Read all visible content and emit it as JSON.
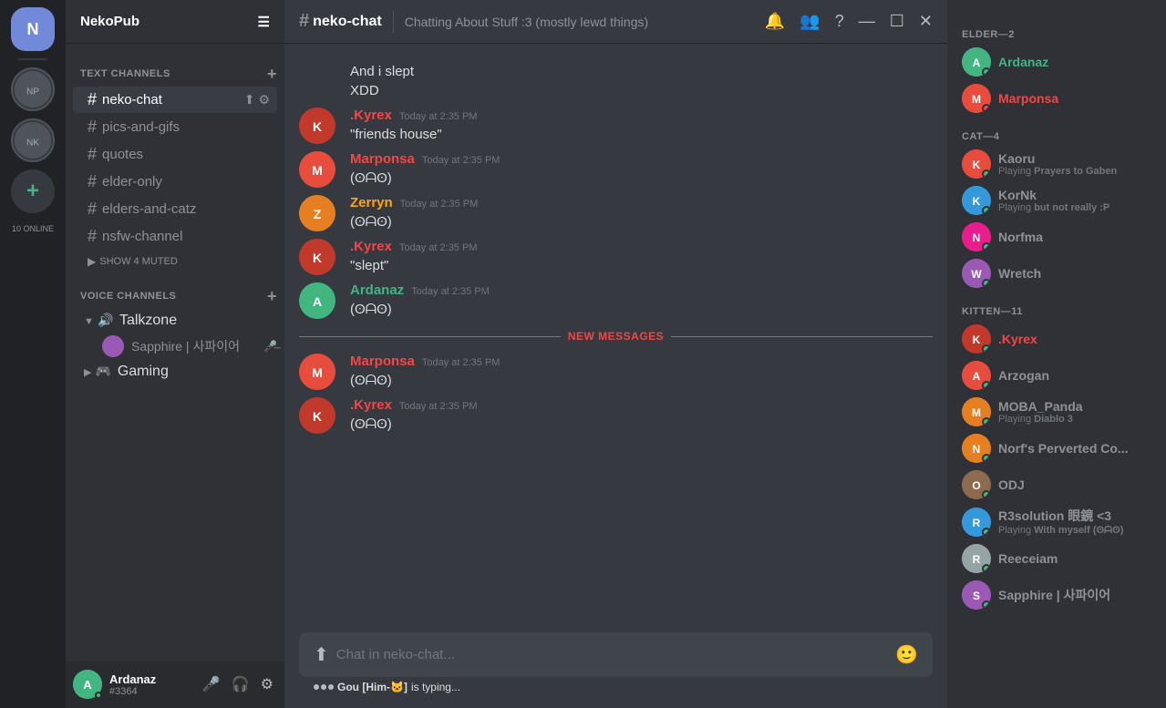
{
  "app": {
    "online_count": "10 ONLINE"
  },
  "server": {
    "name": "NekoPub"
  },
  "channel": {
    "name": "neko-chat",
    "description": "Chatting About Stuff :3 (mostly lewd things)",
    "input_placeholder": "Chat in neko-chat..."
  },
  "text_channels": {
    "header": "TEXT CHANNELS",
    "channels": [
      {
        "name": "neko-chat",
        "active": true
      },
      {
        "name": "pics-and-gifs",
        "active": false
      },
      {
        "name": "quotes",
        "active": false
      },
      {
        "name": "elder-only",
        "active": false
      },
      {
        "name": "elders-and-catz",
        "active": false
      },
      {
        "name": "nsfw-channel",
        "active": false
      }
    ],
    "show_muted": "SHOW 4 MUTED"
  },
  "voice_channels": {
    "header": "VOICE CHANNELS",
    "channels": [
      {
        "name": "Talkzone",
        "users": [
          {
            "name": "Sapphire | 사파이어"
          }
        ]
      },
      {
        "name": "Gaming",
        "users": []
      }
    ]
  },
  "user_panel": {
    "name": "Ardanaz",
    "discriminator": "#3364"
  },
  "messages": [
    {
      "id": "msg1",
      "avatar_class": "av-default",
      "username": "",
      "username_class": "",
      "timestamp": "",
      "lines": [
        "And i slept",
        "XDD"
      ],
      "continuation": true
    },
    {
      "id": "msg2",
      "avatar_class": "av-kyrex",
      "username": ".Kyrex",
      "username_class": "username-kyrex",
      "timestamp": "Today at 2:35 PM",
      "lines": [
        "\"friends house\""
      ],
      "continuation": false
    },
    {
      "id": "msg3",
      "avatar_class": "av-marponsa",
      "username": "Marponsa",
      "username_class": "username-marponsa",
      "timestamp": "Today at 2:35 PM",
      "lines": [
        "(ʘᗩʘ)"
      ],
      "continuation": false
    },
    {
      "id": "msg4",
      "avatar_class": "av-zerryn",
      "username": "Zerryn",
      "username_class": "username-zerryn",
      "timestamp": "Today at 2:35 PM",
      "lines": [
        "(ʘᗩʘ)"
      ],
      "continuation": false
    },
    {
      "id": "msg5",
      "avatar_class": "av-kyrex",
      "username": ".Kyrex",
      "username_class": "username-kyrex",
      "timestamp": "Today at 2:35 PM",
      "lines": [
        "\"slept\""
      ],
      "continuation": false
    },
    {
      "id": "msg6",
      "avatar_class": "av-ardanaz",
      "username": "Ardanaz",
      "username_class": "username-ardanaz",
      "timestamp": "Today at 2:35 PM",
      "lines": [
        "(ʘᗩʘ)"
      ],
      "continuation": false
    }
  ],
  "new_messages_label": "NEW MESSAGES",
  "new_messages_after": [
    {
      "id": "nmsg1",
      "avatar_class": "av-marponsa",
      "username": "Marponsa",
      "username_class": "username-marponsa",
      "timestamp": "Today at 2:35 PM",
      "lines": [
        "(ʘᗩʘ)"
      ],
      "continuation": false
    },
    {
      "id": "nmsg2",
      "avatar_class": "av-kyrex",
      "username": ".Kyrex",
      "username_class": "username-kyrex",
      "timestamp": "Today at 2:35 PM",
      "lines": [
        "(ʘᗩʘ)"
      ],
      "continuation": false
    }
  ],
  "typing": {
    "text": " is typing..."
  },
  "typing_user": "Gou [Him-🐱]",
  "members": {
    "sections": [
      {
        "header": "ELDER—2",
        "members": [
          {
            "name": "Ardanaz",
            "name_class": "ardanaz",
            "avatar_class": "av-ardanaz",
            "status": "status-online",
            "subtext": ""
          },
          {
            "name": "Marponsa",
            "name_class": "marponsa",
            "avatar_class": "av-marponsa",
            "status": "status-dnd",
            "subtext": ""
          }
        ]
      },
      {
        "header": "CAT—4",
        "members": [
          {
            "name": "Kaoru",
            "name_class": "",
            "avatar_class": "av-kaoru",
            "status": "status-online",
            "subtext": "Playing Prayers to Gaben"
          },
          {
            "name": "KorNk",
            "name_class": "",
            "avatar_class": "av-kornk",
            "status": "status-online",
            "subtext": "Playing but not really :P"
          },
          {
            "name": "Norfma",
            "name_class": "",
            "avatar_class": "av-norfma",
            "status": "status-online",
            "subtext": ""
          },
          {
            "name": "Wretch",
            "name_class": "",
            "avatar_class": "av-wretch",
            "status": "status-online",
            "subtext": ""
          }
        ]
      },
      {
        "header": "KITTEN—11",
        "members": [
          {
            "name": ".Kyrex",
            "name_class": "kyrex",
            "avatar_class": "av-kyrex",
            "status": "status-online",
            "subtext": ""
          },
          {
            "name": "Arzogan",
            "name_class": "",
            "avatar_class": "av-arzogan",
            "status": "status-online",
            "subtext": ""
          },
          {
            "name": "MOBA_Panda",
            "name_class": "",
            "avatar_class": "av-moba",
            "status": "status-online",
            "subtext": "Playing Diablo 3"
          },
          {
            "name": "Norf's Perverted Co...",
            "name_class": "",
            "avatar_class": "av-norf-perv",
            "status": "status-online",
            "subtext": ""
          },
          {
            "name": "ODJ",
            "name_class": "",
            "avatar_class": "av-odj",
            "status": "status-online",
            "subtext": ""
          },
          {
            "name": "R3solution 眼鏡 <3",
            "name_class": "",
            "avatar_class": "av-r3",
            "status": "status-online",
            "subtext": "Playing With myself (ʘᗩʘ)"
          },
          {
            "name": "Reeceiam",
            "name_class": "",
            "avatar_class": "av-reeceiam",
            "status": "status-online",
            "subtext": ""
          },
          {
            "name": "Sapphire | 사파이어",
            "name_class": "",
            "avatar_class": "av-sapphire",
            "status": "status-online",
            "subtext": ""
          }
        ]
      }
    ]
  },
  "icons": {
    "hash": "#",
    "hamburger": "☰",
    "bell": "🔔",
    "members_icon": "👥",
    "question": "?",
    "minimize": "—",
    "maximize": "☐",
    "close": "✕",
    "add": "+",
    "settings": "⚙",
    "upload": "⬆",
    "pin": "📌",
    "inbox": "📥",
    "smile": "🙂",
    "upload_file": "📎",
    "mic": "🎤",
    "headphone": "🎧",
    "mute": "🔇"
  }
}
